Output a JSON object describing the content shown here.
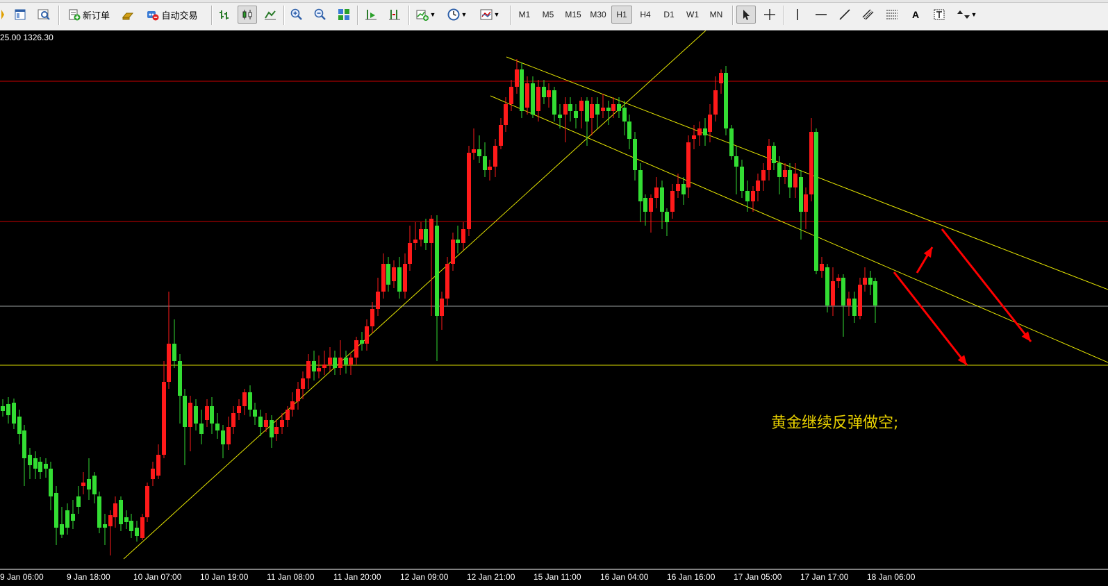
{
  "toolbar": {
    "new_order_label": "新订单",
    "auto_trade_label": "自动交易",
    "timeframes": [
      "M1",
      "M5",
      "M15",
      "M30",
      "H1",
      "H4",
      "D1",
      "W1",
      "MN"
    ],
    "active_timeframe": "H1",
    "text_tool_label": "A"
  },
  "chart": {
    "price_label": "25.00 1326.30",
    "annotation": "黄金继续反弹做空;",
    "x_labels": [
      "9 Jan 06:00",
      "9 Jan 18:00",
      "10 Jan 07:00",
      "10 Jan 19:00",
      "11 Jan 08:00",
      "11 Jan 20:00",
      "12 Jan 09:00",
      "12 Jan 21:00",
      "15 Jan 11:00",
      "16 Jan 04:00",
      "16 Jan 16:00",
      "17 Jan 05:00",
      "17 Jan 17:00",
      "18 Jan 06:00"
    ],
    "colors": {
      "up": "#ff1a1a",
      "down": "#33dd33",
      "hline_red": "#cc0000",
      "hline_yellow": "#dddd00",
      "hline_gray": "#9aa0a0",
      "trendline": "#e6e600",
      "arrow": "#ff0000",
      "annotation": "#e8d000"
    }
  }
}
